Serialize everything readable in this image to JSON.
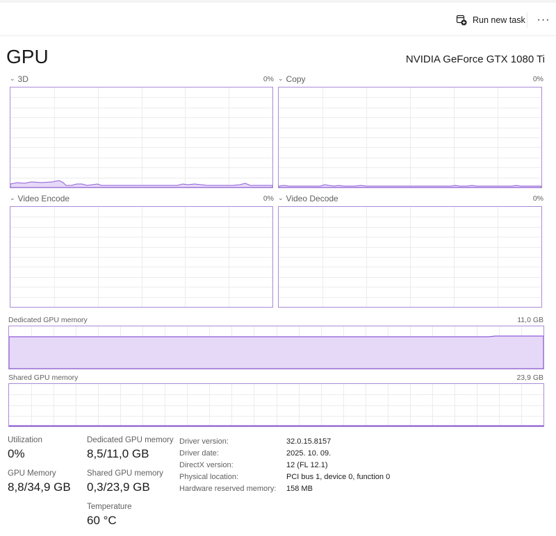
{
  "toolbar": {
    "run_new_task_label": "Run new task",
    "more_label": "···"
  },
  "page": {
    "title": "GPU",
    "device_name": "NVIDIA GeForce GTX 1080 Ti"
  },
  "engines": [
    {
      "name": "3D",
      "percent": "0%"
    },
    {
      "name": "Copy",
      "percent": "0%"
    },
    {
      "name": "Video Encode",
      "percent": "0%"
    },
    {
      "name": "Video Decode",
      "percent": "0%"
    }
  ],
  "memory_graphs": {
    "dedicated": {
      "label": "Dedicated GPU memory",
      "max": "11,0 GB",
      "level_fraction": 0.77
    },
    "shared": {
      "label": "Shared GPU memory",
      "max": "23,9 GB",
      "level_fraction": 0.01
    }
  },
  "stats": {
    "utilization": {
      "label": "Utilization",
      "value": "0%"
    },
    "gpu_memory": {
      "label": "GPU Memory",
      "value": "8,8/34,9 GB"
    },
    "dedicated": {
      "label": "Dedicated GPU memory",
      "value": "8,5/11,0 GB"
    },
    "shared": {
      "label": "Shared GPU memory",
      "value": "0,3/23,9 GB"
    },
    "temperature": {
      "label": "Temperature",
      "value": "60 °C"
    }
  },
  "details": {
    "driver_version": {
      "label": "Driver version:",
      "value": "32.0.15.8157"
    },
    "driver_date": {
      "label": "Driver date:",
      "value": "2025. 10. 09."
    },
    "directx_version": {
      "label": "DirectX version:",
      "value": "12 (FL 12.1)"
    },
    "physical_location": {
      "label": "Physical location:",
      "value": "PCI bus 1, device 0, function 0"
    },
    "hw_reserved": {
      "label": "Hardware reserved memory:",
      "value": "158 MB"
    }
  },
  "colors": {
    "accent": "#8f5cd8",
    "accent_fill": "#e6d9f8",
    "grid": "#ececec",
    "border": "#a98ad6"
  },
  "icons": {
    "run_task": "run-task-icon",
    "chevron": "chevron-down-icon"
  }
}
